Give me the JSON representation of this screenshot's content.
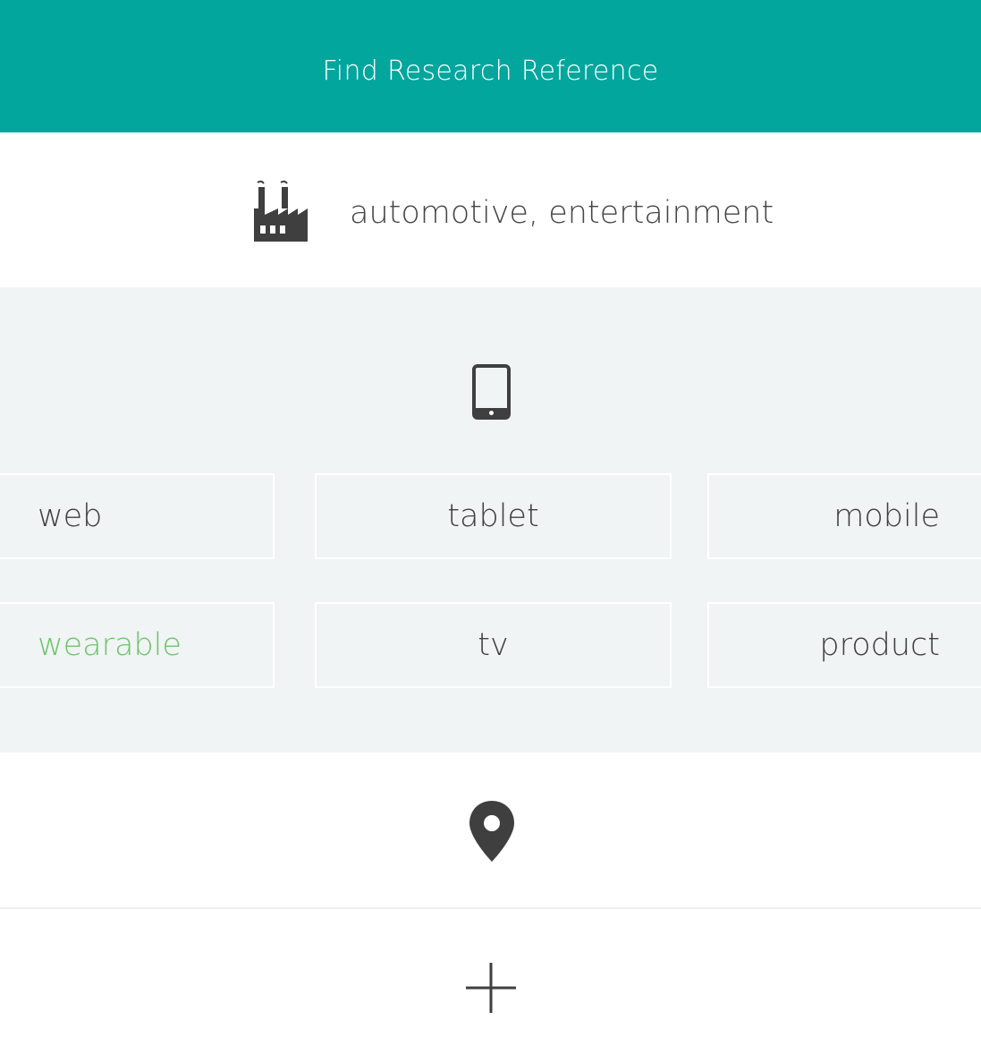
{
  "header": {
    "title": "Find Research Reference"
  },
  "industry": {
    "icon": "factory-icon",
    "value": "automotive, entertainment"
  },
  "platforms": {
    "icon": "tablet-icon",
    "items": [
      {
        "label": "web",
        "selected": false
      },
      {
        "label": "tablet",
        "selected": false
      },
      {
        "label": "mobile",
        "selected": false
      },
      {
        "label": "wearable",
        "selected": true
      },
      {
        "label": "tv",
        "selected": false
      },
      {
        "label": "product",
        "selected": false
      }
    ]
  },
  "location": {
    "icon": "map-pin-icon"
  },
  "add": {
    "icon": "plus-icon"
  },
  "colors": {
    "header_bg": "#02a69c",
    "section_bg": "#f1f4f4",
    "selected_text": "#6cc56c",
    "icon": "#3f3f3f"
  }
}
